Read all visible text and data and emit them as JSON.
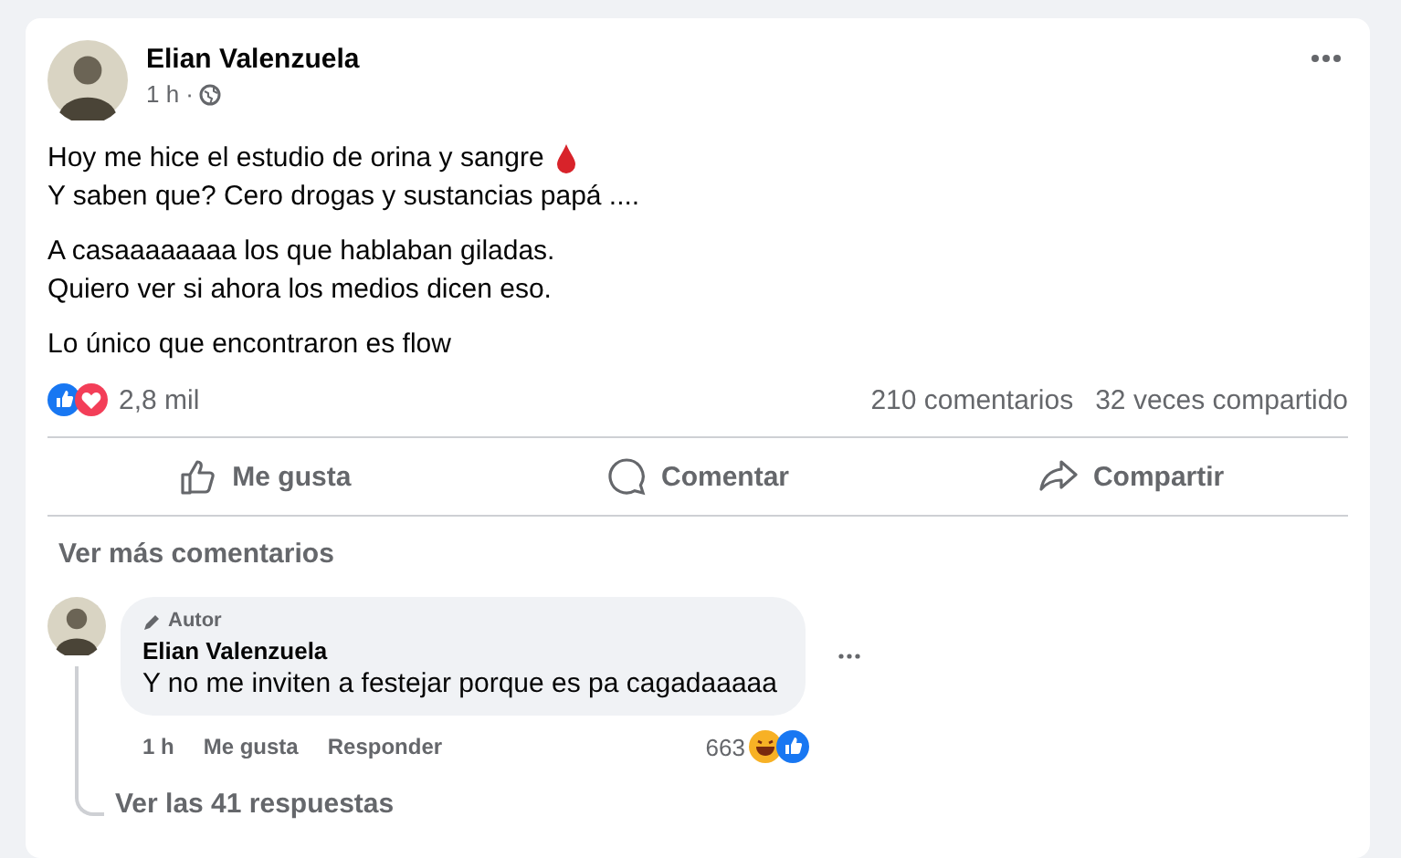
{
  "post": {
    "author": "Elian Valenzuela",
    "time": "1 h ·",
    "paragraphs": [
      [
        "Hoy me hice el estudio de orina y sangre",
        "Y saben que? Cero drogas y sustancias papá ...."
      ],
      [
        "A casaaaaaaaa los que hablaban giladas.",
        "Quiero ver si ahora los medios dicen eso."
      ],
      [
        "Lo único que encontraron es flow"
      ]
    ],
    "reactions_count": "2,8 mil",
    "comments_count": "210 comentarios",
    "shares_count": "32 veces compartido"
  },
  "actions": [
    {
      "kind": "like",
      "label": "Me gusta"
    },
    {
      "kind": "comment",
      "label": "Comentar"
    },
    {
      "kind": "share",
      "label": "Compartir"
    }
  ],
  "more_comments": "Ver más comentarios",
  "comment": {
    "badge": "Autor",
    "author": "Elian Valenzuela",
    "text": "Y no me inviten a festejar porque es pa cagadaaaaa",
    "time": "1 h",
    "like": "Me gusta",
    "reply": "Responder",
    "reactions_count": "663",
    "replies_link": "Ver las 41 respuestas"
  }
}
